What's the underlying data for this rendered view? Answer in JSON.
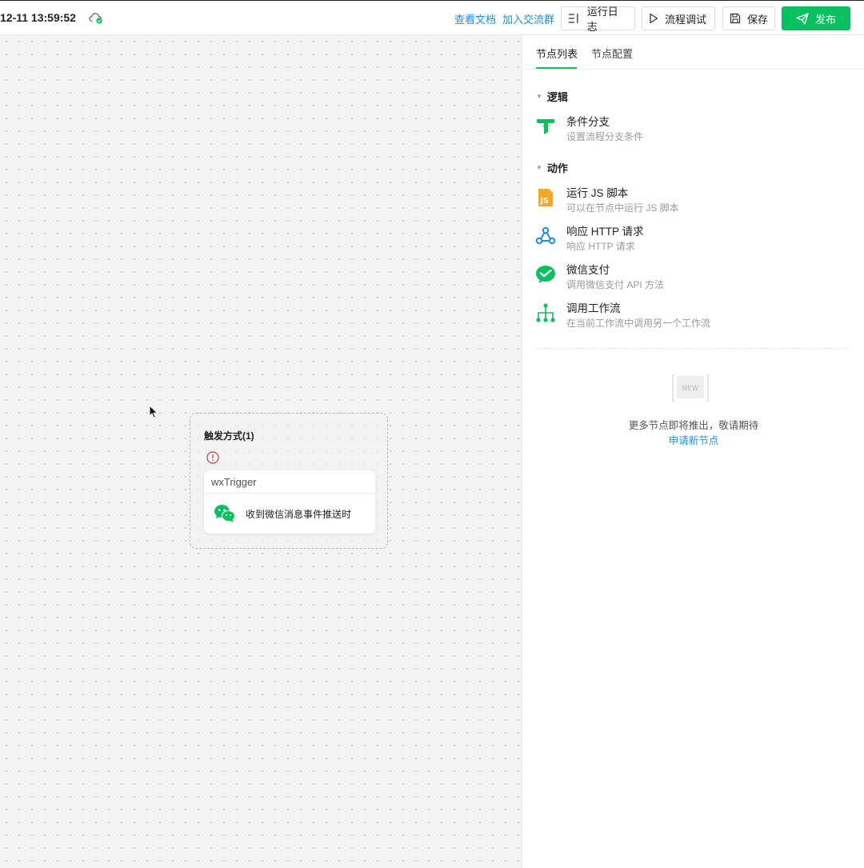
{
  "header": {
    "save_time": "12-11 13:59:52",
    "docs_link": "查看文档",
    "group_link": "加入交流群",
    "logs_button": "运行日志",
    "debug_button": "流程调试",
    "save_button": "保存",
    "publish_button": "发布"
  },
  "canvas": {
    "trigger_group_title": "触发方式(1)",
    "trigger_card": {
      "name": "wxTrigger",
      "description": "收到微信消息事件推送时"
    }
  },
  "panel": {
    "tabs": [
      "节点列表",
      "节点配置"
    ],
    "sections": [
      {
        "title": "逻辑",
        "items": [
          {
            "name": "条件分支",
            "desc": "设置流程分支条件",
            "icon": "filter-icon"
          }
        ]
      },
      {
        "title": "动作",
        "items": [
          {
            "name": "运行 JS 脚本",
            "desc": "可以在节点中运行 JS 脚本",
            "icon": "js-icon"
          },
          {
            "name": "响应 HTTP 请求",
            "desc": "响应 HTTP 请求",
            "icon": "webhook-icon"
          },
          {
            "name": "微信支付",
            "desc": "调用微信支付 API 方法",
            "icon": "wechat-pay-icon"
          },
          {
            "name": "调用工作流",
            "desc": "在当前工作流中调用另一个工作流",
            "icon": "workflow-icon"
          }
        ]
      }
    ],
    "new_badge": "NEW",
    "more_text": "更多节点即将推出，敬请期待",
    "apply_link": "申请新节点"
  },
  "colors": {
    "brand_green": "#07c160",
    "link_blue": "#1a8fe0",
    "js_orange": "#f5a623",
    "webhook_blue": "#1a8fe0",
    "warning_red": "#d9363e"
  }
}
